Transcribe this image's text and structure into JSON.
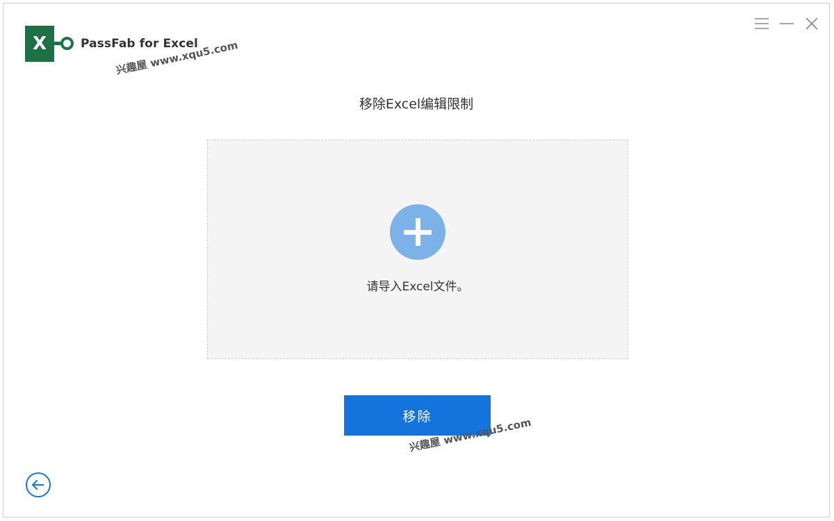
{
  "app": {
    "logo_letter": "X",
    "name": "PassFab for Excel"
  },
  "window_controls": {
    "menu_icon": "hamburger-menu-icon",
    "minimize_icon": "minimize-icon",
    "close_icon": "close-icon"
  },
  "main": {
    "title": "移除Excel编辑限制",
    "drop_zone": {
      "icon": "add-plus-icon",
      "hint": "请导入Excel文件。"
    },
    "remove_button_label": "移除"
  },
  "footer": {
    "back_icon": "arrow-left-circle-icon"
  },
  "watermarks": [
    "兴趣屋 www.xqu5.com",
    "兴趣屋 www.xqu5.com"
  ],
  "colors": {
    "excel_green": "#1e7145",
    "accent_blue": "#1473dc",
    "plus_circle": "#7cb2e8",
    "drop_zone_bg": "#f4f4f4"
  }
}
